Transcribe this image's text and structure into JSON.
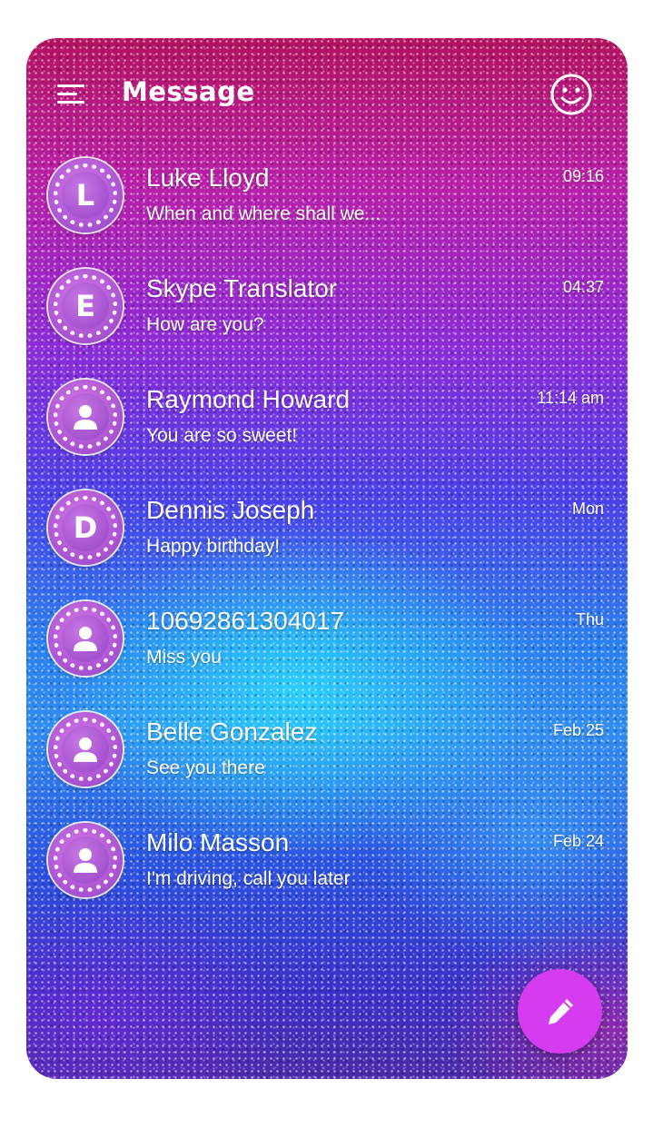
{
  "header": {
    "title": "Message"
  },
  "icons": {
    "menu": "menu-icon",
    "account": "smiley-icon",
    "compose": "pencil-icon",
    "contact": "person-icon"
  },
  "colors": {
    "fab": "#d53cf0",
    "avatar": "#b25ad6",
    "text": "#ffffff"
  },
  "conversations": [
    {
      "avatar_letter": "L",
      "name": "Luke Lloyd",
      "preview": "When and where shall we...",
      "time": "09:16"
    },
    {
      "avatar_letter": "E",
      "name": "Skype Translator",
      "preview": "How are you?",
      "time": "04:37"
    },
    {
      "avatar_letter": "",
      "name": "Raymond Howard",
      "preview": "You are so sweet!",
      "time": "11:14 am"
    },
    {
      "avatar_letter": "D",
      "name": "Dennis Joseph",
      "preview": "Happy birthday!",
      "time": "Mon"
    },
    {
      "avatar_letter": "",
      "name": "10692861304017",
      "preview": "Miss you",
      "time": "Thu"
    },
    {
      "avatar_letter": "",
      "name": "Belle Gonzalez",
      "preview": "See you there",
      "time": "Feb 25"
    },
    {
      "avatar_letter": "",
      "name": "Milo Masson",
      "preview": "I'm driving, call you later",
      "time": "Feb 24"
    }
  ]
}
